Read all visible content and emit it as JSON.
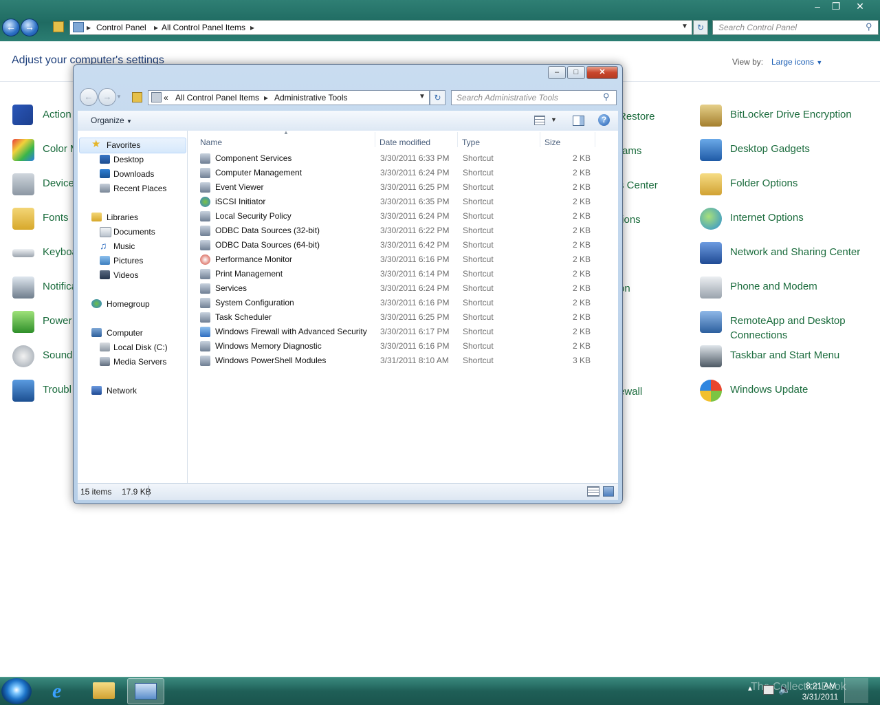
{
  "background_window": {
    "address": {
      "root": "Control Panel",
      "current": "All Control Panel Items"
    },
    "search_placeholder": "Search Control Panel",
    "heading": "Adjust your computer's settings",
    "view_by_label": "View by:",
    "view_by_value": "Large icons",
    "items_left": [
      "Action C",
      "Color M",
      "Device",
      "Fonts",
      "Keyboa",
      "Notifica",
      "Power O",
      "Sound",
      "Troubl"
    ],
    "items_middle": [
      "Restore",
      "rams",
      "s Center",
      "tions",
      "",
      "on",
      "",
      "",
      "ewall"
    ],
    "items_right": [
      "BitLocker Drive Encryption",
      "Desktop Gadgets",
      "Folder Options",
      "Internet Options",
      "Network and Sharing Center",
      "Phone and Modem",
      "RemoteApp and Desktop Connections",
      "Taskbar and Start Menu",
      "Windows Update"
    ]
  },
  "window": {
    "address": {
      "prefix": "«",
      "parent": "All Control Panel Items",
      "current": "Administrative Tools"
    },
    "search_placeholder": "Search Administrative Tools",
    "toolbar": {
      "organize": "Organize"
    },
    "nav": {
      "favorites": "Favorites",
      "desktop": "Desktop",
      "downloads": "Downloads",
      "recent": "Recent Places",
      "libraries": "Libraries",
      "documents": "Documents",
      "music": "Music",
      "pictures": "Pictures",
      "videos": "Videos",
      "homegroup": "Homegroup",
      "computer": "Computer",
      "local_disk": "Local Disk (C:)",
      "media_servers": "Media Servers",
      "network": "Network"
    },
    "columns": {
      "name": "Name",
      "date": "Date modified",
      "type": "Type",
      "size": "Size"
    },
    "files": [
      {
        "name": "Component Services",
        "date": "3/30/2011 6:33 PM",
        "type": "Shortcut",
        "size": "2 KB"
      },
      {
        "name": "Computer Management",
        "date": "3/30/2011 6:24 PM",
        "type": "Shortcut",
        "size": "2 KB"
      },
      {
        "name": "Event Viewer",
        "date": "3/30/2011 6:25 PM",
        "type": "Shortcut",
        "size": "2 KB"
      },
      {
        "name": "iSCSI Initiator",
        "date": "3/30/2011 6:35 PM",
        "type": "Shortcut",
        "size": "2 KB"
      },
      {
        "name": "Local Security Policy",
        "date": "3/30/2011 6:24 PM",
        "type": "Shortcut",
        "size": "2 KB"
      },
      {
        "name": "ODBC Data Sources (32-bit)",
        "date": "3/30/2011 6:22 PM",
        "type": "Shortcut",
        "size": "2 KB"
      },
      {
        "name": "ODBC Data Sources (64-bit)",
        "date": "3/30/2011 6:42 PM",
        "type": "Shortcut",
        "size": "2 KB"
      },
      {
        "name": "Performance Monitor",
        "date": "3/30/2011 6:16 PM",
        "type": "Shortcut",
        "size": "2 KB"
      },
      {
        "name": "Print Management",
        "date": "3/30/2011 6:14 PM",
        "type": "Shortcut",
        "size": "2 KB"
      },
      {
        "name": "Services",
        "date": "3/30/2011 6:24 PM",
        "type": "Shortcut",
        "size": "2 KB"
      },
      {
        "name": "System Configuration",
        "date": "3/30/2011 6:16 PM",
        "type": "Shortcut",
        "size": "2 KB"
      },
      {
        "name": "Task Scheduler",
        "date": "3/30/2011 6:25 PM",
        "type": "Shortcut",
        "size": "2 KB"
      },
      {
        "name": "Windows Firewall with Advanced Security",
        "date": "3/30/2011 6:17 PM",
        "type": "Shortcut",
        "size": "2 KB"
      },
      {
        "name": "Windows Memory Diagnostic",
        "date": "3/30/2011 6:16 PM",
        "type": "Shortcut",
        "size": "2 KB"
      },
      {
        "name": "Windows PowerShell Modules",
        "date": "3/31/2011 8:10 AM",
        "type": "Shortcut",
        "size": "3 KB"
      }
    ],
    "status": {
      "count": "15 items",
      "size": "17.9 KB"
    }
  },
  "taskbar": {
    "time": "8:21 AM",
    "date": "3/31/2011",
    "watermark": "The CollectionBook"
  },
  "colors": {
    "link_green": "#1a6b3c",
    "titlebar_teal": "#2b7d72",
    "selection_blue": "#cfe3fb"
  }
}
